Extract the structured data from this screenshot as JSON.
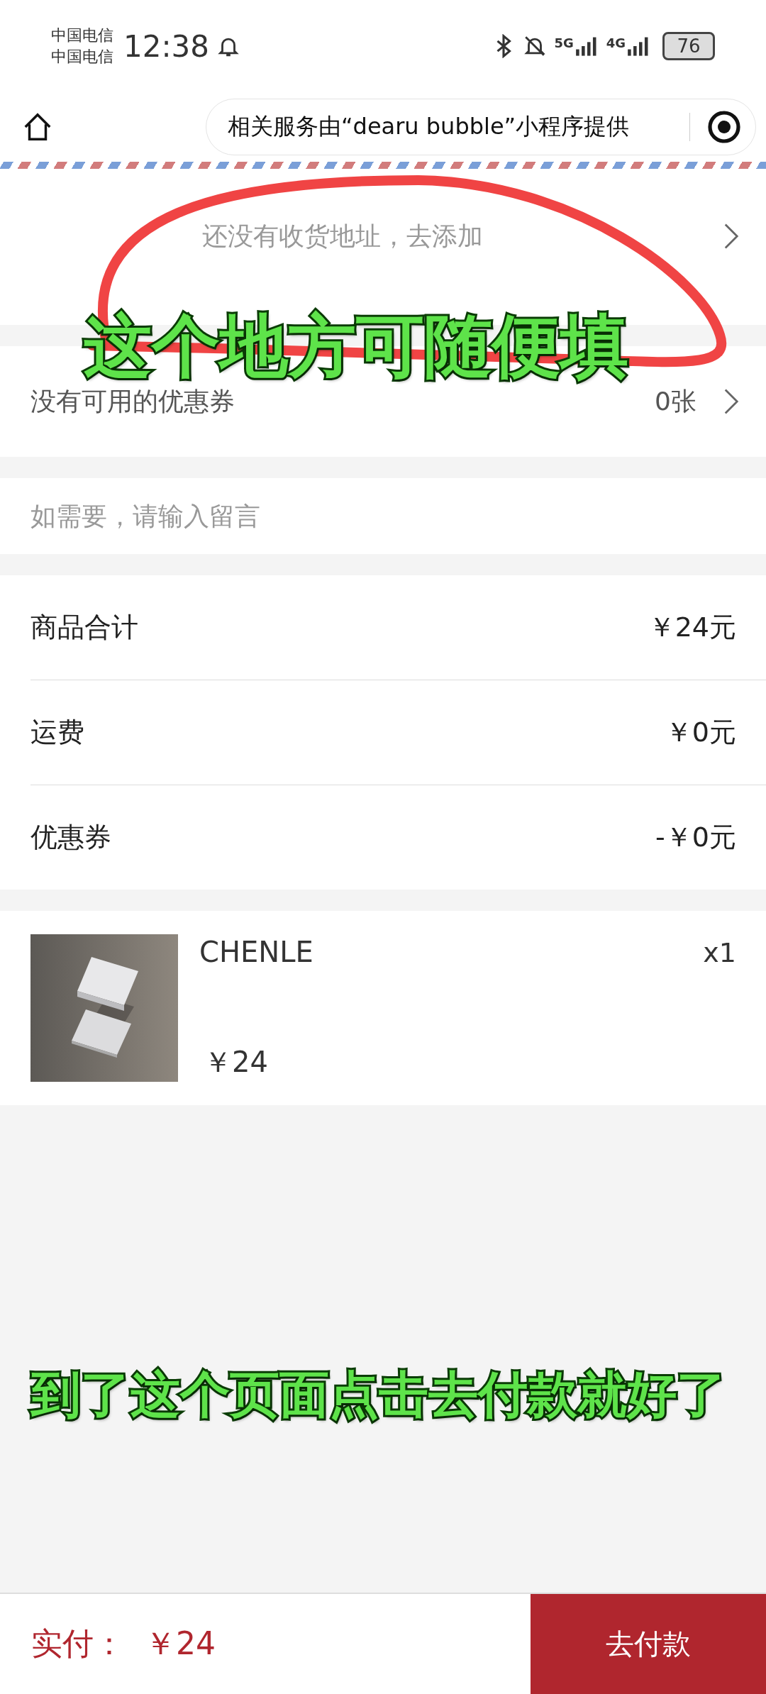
{
  "status_bar": {
    "carriers": [
      "中国电信",
      "中国电信"
    ],
    "time": "12:38",
    "networks": [
      "5G",
      "4G"
    ],
    "battery": "76"
  },
  "nav_bar": {
    "capsule_text": "相关服务由“dearu bubble”小程序提供"
  },
  "address": {
    "placeholder": "还没有收货地址，去添加"
  },
  "coupon": {
    "label": "没有可用的优惠券",
    "count": "0张"
  },
  "message": {
    "placeholder": "如需要，请输入留言"
  },
  "summary": [
    {
      "label": "商品合计",
      "value": "￥24元"
    },
    {
      "label": "运费",
      "value": "￥0元"
    },
    {
      "label": "优惠券",
      "value": "-￥0元"
    }
  ],
  "products": [
    {
      "kind": "picture",
      "name": "CHENLE",
      "price": "￥24",
      "quantity": "x1"
    }
  ],
  "annotations": [
    "这个地方可随便填",
    "到了这个页面点击去付款就好了"
  ],
  "bottom_bar": {
    "total_label": "实付：",
    "total": "￥24",
    "pay_button": "去付款"
  }
}
